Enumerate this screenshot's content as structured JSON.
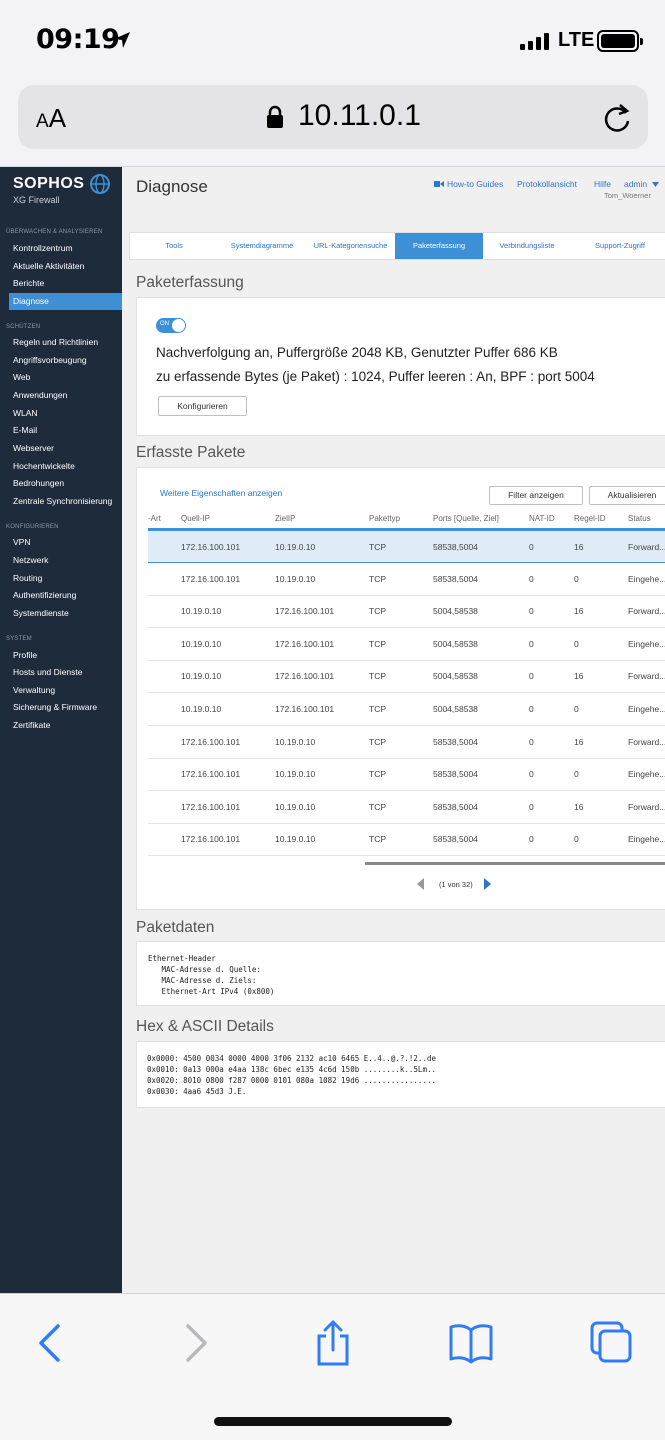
{
  "status_bar": {
    "time": "09:19",
    "network": "LTE"
  },
  "browser": {
    "text_size_label_small": "A",
    "text_size_label_large": "A",
    "url": "10.11.0.1"
  },
  "sidebar": {
    "brand": "SOPHOS",
    "product": "XG Firewall",
    "sections": [
      {
        "label": "ÜBERWACHEN & ANALYSIEREN",
        "items": [
          "Kontrollzentrum",
          "Aktuelle Aktivitäten",
          "Berichte",
          "Diagnose"
        ]
      },
      {
        "label": "SCHÜTZEN",
        "items": [
          "Regeln und Richtlinien",
          "Angriffsvorbeugung",
          "Web",
          "Anwendungen",
          "WLAN",
          "E-Mail",
          "Webserver",
          "Hochentwickelte",
          "Bedrohungen",
          "Zentrale Synchronisierung"
        ]
      },
      {
        "label": "KONFIGURIEREN",
        "items": [
          "VPN",
          "Netzwerk",
          "Routing",
          "Authentifizierung",
          "Systemdienste"
        ]
      },
      {
        "label": "SYSTEM",
        "items": [
          "Profile",
          "Hosts und Dienste",
          "Verwaltung",
          "Sicherung & Firmware",
          "Zertifikate"
        ]
      }
    ],
    "active_item": "Diagnose"
  },
  "header": {
    "title": "Diagnose",
    "howto": "How-to Guides",
    "log": "Protokollansicht",
    "help": "Hilfe",
    "user": "admin",
    "user_sub": "Tom_Woerner"
  },
  "tabs": [
    "Tools",
    "Systemdiagramme",
    "URL-Kategoriensuche",
    "Paketerfassung",
    "Verbindungsliste",
    "Support-Zugriff"
  ],
  "active_tab": "Paketerfassung",
  "capture": {
    "section_title": "Paketerfassung",
    "toggle_label": "ON",
    "line1": "Nachverfolgung an, Puffergröße 2048 KB, Genutzter Puffer 686 KB",
    "line2": "zu erfassende Bytes (je Paket) : 1024, Puffer leeren : An, BPF : port 5004",
    "configure_button": "Konfigurieren"
  },
  "packets": {
    "section_title": "Erfasste Pakete",
    "more_props_link": "Weitere Eigenschaften anzeigen",
    "filter_button": "Filter anzeigen",
    "refresh_button": "Aktualisieren",
    "columns": [
      "-Art",
      "Quell-IP",
      "ZielIP",
      "Pakettyp",
      "Ports [Quelle, Ziel]",
      "NAT-ID",
      "Regel-ID",
      "Status"
    ],
    "rows": [
      [
        "172.16.100.101",
        "10.19.0.10",
        "TCP",
        "58538,5004",
        "0",
        "16",
        "Forward..."
      ],
      [
        "172.16.100.101",
        "10.19.0.10",
        "TCP",
        "58538,5004",
        "0",
        "0",
        "Eingehe..."
      ],
      [
        "10.19.0.10",
        "172.16.100.101",
        "TCP",
        "5004,58538",
        "0",
        "16",
        "Forward..."
      ],
      [
        "10.19.0.10",
        "172.16.100.101",
        "TCP",
        "5004,58538",
        "0",
        "0",
        "Eingehe..."
      ],
      [
        "10.19.0.10",
        "172.16.100.101",
        "TCP",
        "5004,58538",
        "0",
        "16",
        "Forward..."
      ],
      [
        "10.19.0.10",
        "172.16.100.101",
        "TCP",
        "5004,58538",
        "0",
        "0",
        "Eingehe..."
      ],
      [
        "172.16.100.101",
        "10.19.0.10",
        "TCP",
        "58538,5004",
        "0",
        "16",
        "Forward..."
      ],
      [
        "172.16.100.101",
        "10.19.0.10",
        "TCP",
        "58538,5004",
        "0",
        "0",
        "Eingehe..."
      ],
      [
        "172.16.100.101",
        "10.19.0.10",
        "TCP",
        "58538,5004",
        "0",
        "16",
        "Forward..."
      ],
      [
        "172.16.100.101",
        "10.19.0.10",
        "TCP",
        "58538,5004",
        "0",
        "0",
        "Eingehe..."
      ]
    ],
    "selected_row": 0,
    "pager": "(1 von 32)"
  },
  "packet_data": {
    "section_title": "Paketdaten",
    "lines": [
      "Ethernet-Header",
      "   MAC-Adresse d. Quelle:",
      "   MAC-Adresse d. Ziels:",
      "   Ethernet-Art IPv4 (0x800)"
    ]
  },
  "hex": {
    "section_title": "Hex & ASCII Details",
    "lines": [
      "0x0000: 4500 0034 0000 4000 3f06 2132 ac10 6465 E..4..@.?.!2..de",
      "0x0010: 0a13 000a e4aa 138c 6bec e135 4c6d 150b ........k..5Lm..",
      "0x0020: 8010 0800 f287 0000 0101 080a 1082 19d6 ................",
      "0x0030: 4aa6 45d3 J.E."
    ]
  },
  "colors": {
    "sidebar_bg": "#1e2b3a",
    "accent": "#3d8fd6",
    "link": "#2a76c8",
    "ios_blue": "#2f7cf6"
  }
}
